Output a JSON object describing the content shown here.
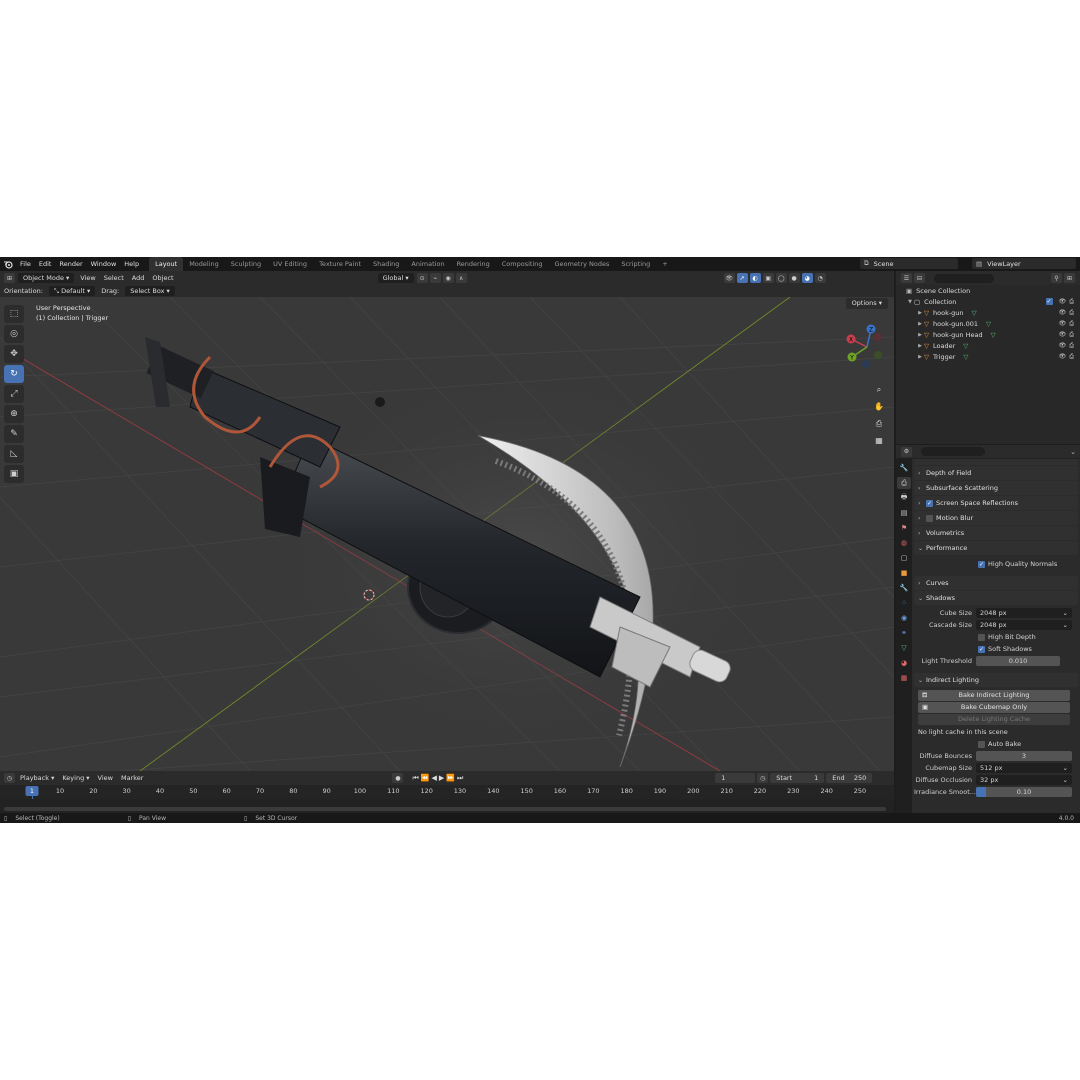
{
  "menubar": {
    "items": [
      "File",
      "Edit",
      "Render",
      "Window",
      "Help"
    ],
    "workspaces": [
      "Layout",
      "Modeling",
      "Sculpting",
      "UV Editing",
      "Texture Paint",
      "Shading",
      "Animation",
      "Rendering",
      "Compositing",
      "Geometry Nodes",
      "Scripting"
    ],
    "active_workspace": "Layout",
    "add_tab": "+",
    "scene": "Scene",
    "view_layer": "ViewLayer"
  },
  "viewport_header": {
    "mode": "Object Mode",
    "menus": [
      "View",
      "Select",
      "Add",
      "Object"
    ],
    "transform_orientation": "Global",
    "orientation_label": "Orientation:",
    "orientation_value": "Default",
    "drag_label": "Drag:",
    "drag_value": "Select Box",
    "options": "Options"
  },
  "viewport": {
    "perspective": "User Perspective",
    "collection_info": "(1) Collection | Trigger",
    "gizmo": {
      "x": "X",
      "y": "Y",
      "z": "Z"
    },
    "colors": {
      "x_axis": "#c9404f",
      "y_axis": "#6ea326",
      "z_axis": "#3b73c8",
      "grid_x": "#9a3b42",
      "grid_y": "#6f8a2c"
    }
  },
  "timeline": {
    "menus": [
      "Playback",
      "Keying",
      "View",
      "Marker"
    ],
    "current_frame": "1",
    "start_label": "Start",
    "start": "1",
    "end_label": "End",
    "end": "250",
    "ruler": [
      "10",
      "20",
      "30",
      "40",
      "50",
      "60",
      "70",
      "80",
      "90",
      "100",
      "110",
      "120",
      "130",
      "140",
      "150",
      "160",
      "170",
      "180",
      "190",
      "200",
      "210",
      "220",
      "230",
      "240",
      "250"
    ],
    "indicator": "1"
  },
  "statusbar": {
    "select": "Select (Toggle)",
    "pan": "Pan View",
    "cursor": "Set 3D Cursor",
    "version": "4.0.0"
  },
  "outliner": {
    "root": "Scene Collection",
    "collection": "Collection",
    "objects": [
      "hook-gun",
      "hook-gun.001",
      "hook-gun Head",
      "Loader",
      "Trigger"
    ]
  },
  "properties": {
    "panels_top": [
      {
        "label": "Depth of Field"
      },
      {
        "label": "Subsurface Scattering"
      },
      {
        "label": "Screen Space Reflections",
        "checkbox": true
      },
      {
        "label": "Motion Blur",
        "checkbox": false
      },
      {
        "label": "Volumetrics"
      }
    ],
    "performance": {
      "label": "Performance",
      "high_quality_normals": "High Quality Normals"
    },
    "curves": "Curves",
    "shadows": {
      "label": "Shadows",
      "cube_size_label": "Cube Size",
      "cube_size": "2048 px",
      "cascade_size_label": "Cascade Size",
      "cascade_size": "2048 px",
      "high_bit_depth": "High Bit Depth",
      "soft_shadows": "Soft Shadows",
      "light_threshold_label": "Light Threshold",
      "light_threshold": "0.010"
    },
    "indirect": {
      "label": "Indirect Lighting",
      "bake_indirect": "Bake Indirect Lighting",
      "bake_cubemap": "Bake Cubemap Only",
      "delete_cache": "Delete Lighting Cache",
      "no_cache": "No light cache in this scene",
      "auto_bake": "Auto Bake",
      "diffuse_bounces_label": "Diffuse Bounces",
      "diffuse_bounces": "3",
      "cubemap_size_label": "Cubemap Size",
      "cubemap_size": "512 px",
      "diffuse_occlusion_label": "Diffuse Occlusion",
      "diffuse_occlusion": "32 px",
      "irradiance_smooth_label": "Irradiance Smoot...",
      "irradiance_smooth": "0.10",
      "irradiance_smooth_fraction": 0.1
    }
  }
}
